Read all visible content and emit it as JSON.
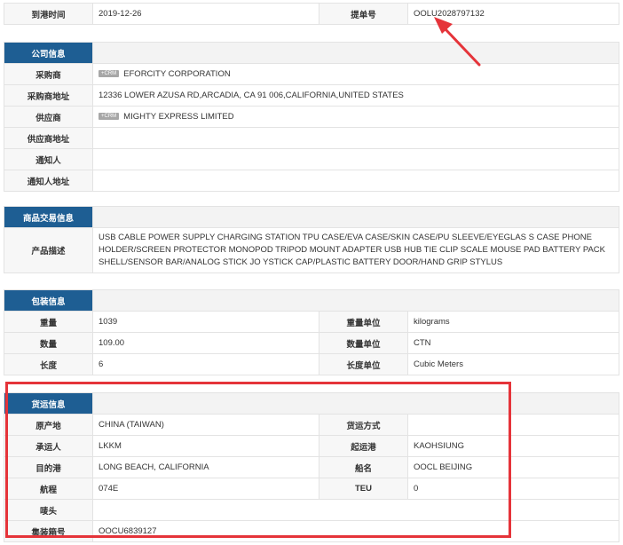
{
  "arrival": {
    "label": "到港时间",
    "date": "2019-12-26",
    "bl_label": "提单号",
    "bl_no": "OOLU2028797132"
  },
  "company": {
    "title": "公司信息",
    "badge": "+CRM",
    "buyer_label": "采购商",
    "buyer": "EFORCITY CORPORATION",
    "buyer_addr_label": "采购商地址",
    "buyer_addr": "12336 LOWER AZUSA RD,ARCADIA, CA 91 006,CALIFORNIA,UNITED STATES",
    "supplier_label": "供应商",
    "supplier": "MIGHTY EXPRESS LIMITED",
    "supplier_addr_label": "供应商地址",
    "supplier_addr": "",
    "notify_label": "通知人",
    "notify": "",
    "notify_addr_label": "通知人地址",
    "notify_addr": ""
  },
  "goods": {
    "title": "商品交易信息",
    "desc_label": "产品描述",
    "desc": "USB CABLE POWER SUPPLY CHARGING STATION TPU CASE/EVA CASE/SKIN CASE/PU SLEEVE/EYEGLAS S CASE PHONE HOLDER/SCREEN PROTECTOR MONOPOD TRIPOD MOUNT ADAPTER USB HUB TIE CLIP SCALE MOUSE PAD BATTERY PACK SHELL/SENSOR BAR/ANALOG STICK JO YSTICK CAP/PLASTIC BATTERY DOOR/HAND GRIP STYLUS"
  },
  "packing": {
    "title": "包装信息",
    "rows": [
      {
        "l1": "重量",
        "v1": "1039",
        "l2": "重量单位",
        "v2": "kilograms"
      },
      {
        "l1": "数量",
        "v1": "109.00",
        "l2": "数量单位",
        "v2": "CTN"
      },
      {
        "l1": "长度",
        "v1": "6",
        "l2": "长度单位",
        "v2": "Cubic Meters"
      }
    ]
  },
  "shipping": {
    "title": "货运信息",
    "rows": [
      {
        "l1": "原产地",
        "v1": "CHINA (TAIWAN)",
        "l2": "货运方式",
        "v2": ""
      },
      {
        "l1": "承运人",
        "v1": "LKKM",
        "l2": "起运港",
        "v2": "KAOHSIUNG"
      },
      {
        "l1": "目的港",
        "v1": "LONG BEACH, CALIFORNIA",
        "l2": "船名",
        "v2": "OOCL BEIJING"
      },
      {
        "l1": "航程",
        "v1": "074E",
        "l2": "TEU",
        "v2": "0"
      }
    ],
    "mark_label": "唛头",
    "mark": "",
    "container_label": "集装箱号",
    "container": "OOCU6839127"
  },
  "colors": {
    "section_header": "#1e5e93",
    "highlight": "#e5343a"
  }
}
